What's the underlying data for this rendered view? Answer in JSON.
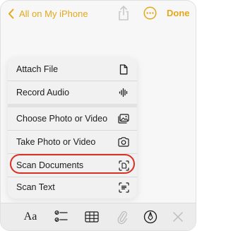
{
  "nav": {
    "back_label": "All on My iPhone",
    "done_label": "Done",
    "accent_color": "#e3a81a"
  },
  "menu": {
    "items": [
      {
        "label": "Attach File",
        "icon": "document-icon"
      },
      {
        "label": "Record Audio",
        "icon": "waveform-icon"
      },
      {
        "label": "Choose Photo or Video",
        "icon": "photo-library-icon"
      },
      {
        "label": "Take Photo or Video",
        "icon": "camera-icon"
      },
      {
        "label": "Scan Documents",
        "icon": "scan-document-icon",
        "highlighted": true
      },
      {
        "label": "Scan Text",
        "icon": "scan-text-icon"
      }
    ]
  },
  "toolbar": {
    "format_label": "Aa",
    "items": [
      "format-text-icon",
      "checklist-icon",
      "table-icon",
      "paperclip-icon",
      "markup-pen-icon",
      "close-icon"
    ]
  }
}
